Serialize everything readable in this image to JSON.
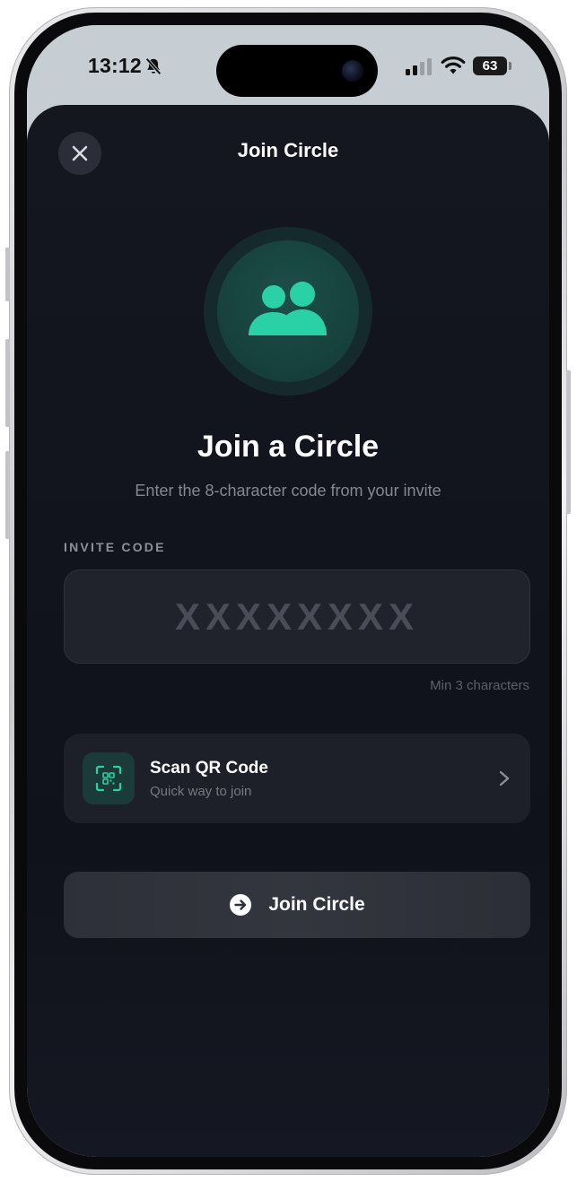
{
  "status_bar": {
    "time": "13:12",
    "battery": "63",
    "icons": [
      "bell-slash-icon",
      "cellular-signal-icon",
      "wifi-icon",
      "battery-icon"
    ]
  },
  "sheet": {
    "title": "Join Circle",
    "close_icon": "close-icon"
  },
  "hero": {
    "icon": "people-icon",
    "heading": "Join a Circle",
    "subtitle": "Enter the 8-character code from your invite"
  },
  "invite": {
    "label": "INVITE CODE",
    "value": "",
    "placeholder": "XXXXXXXX",
    "hint": "Min 3 characters"
  },
  "qr": {
    "icon": "qr-scan-icon",
    "title": "Scan QR Code",
    "subtitle": "Quick way to join"
  },
  "action": {
    "icon": "arrow-circle-right-icon",
    "label": "Join Circle"
  },
  "colors": {
    "accent": "#2ad1a6",
    "sheet_background": "#12141d",
    "status_bar_background": "#c6cdd3"
  }
}
